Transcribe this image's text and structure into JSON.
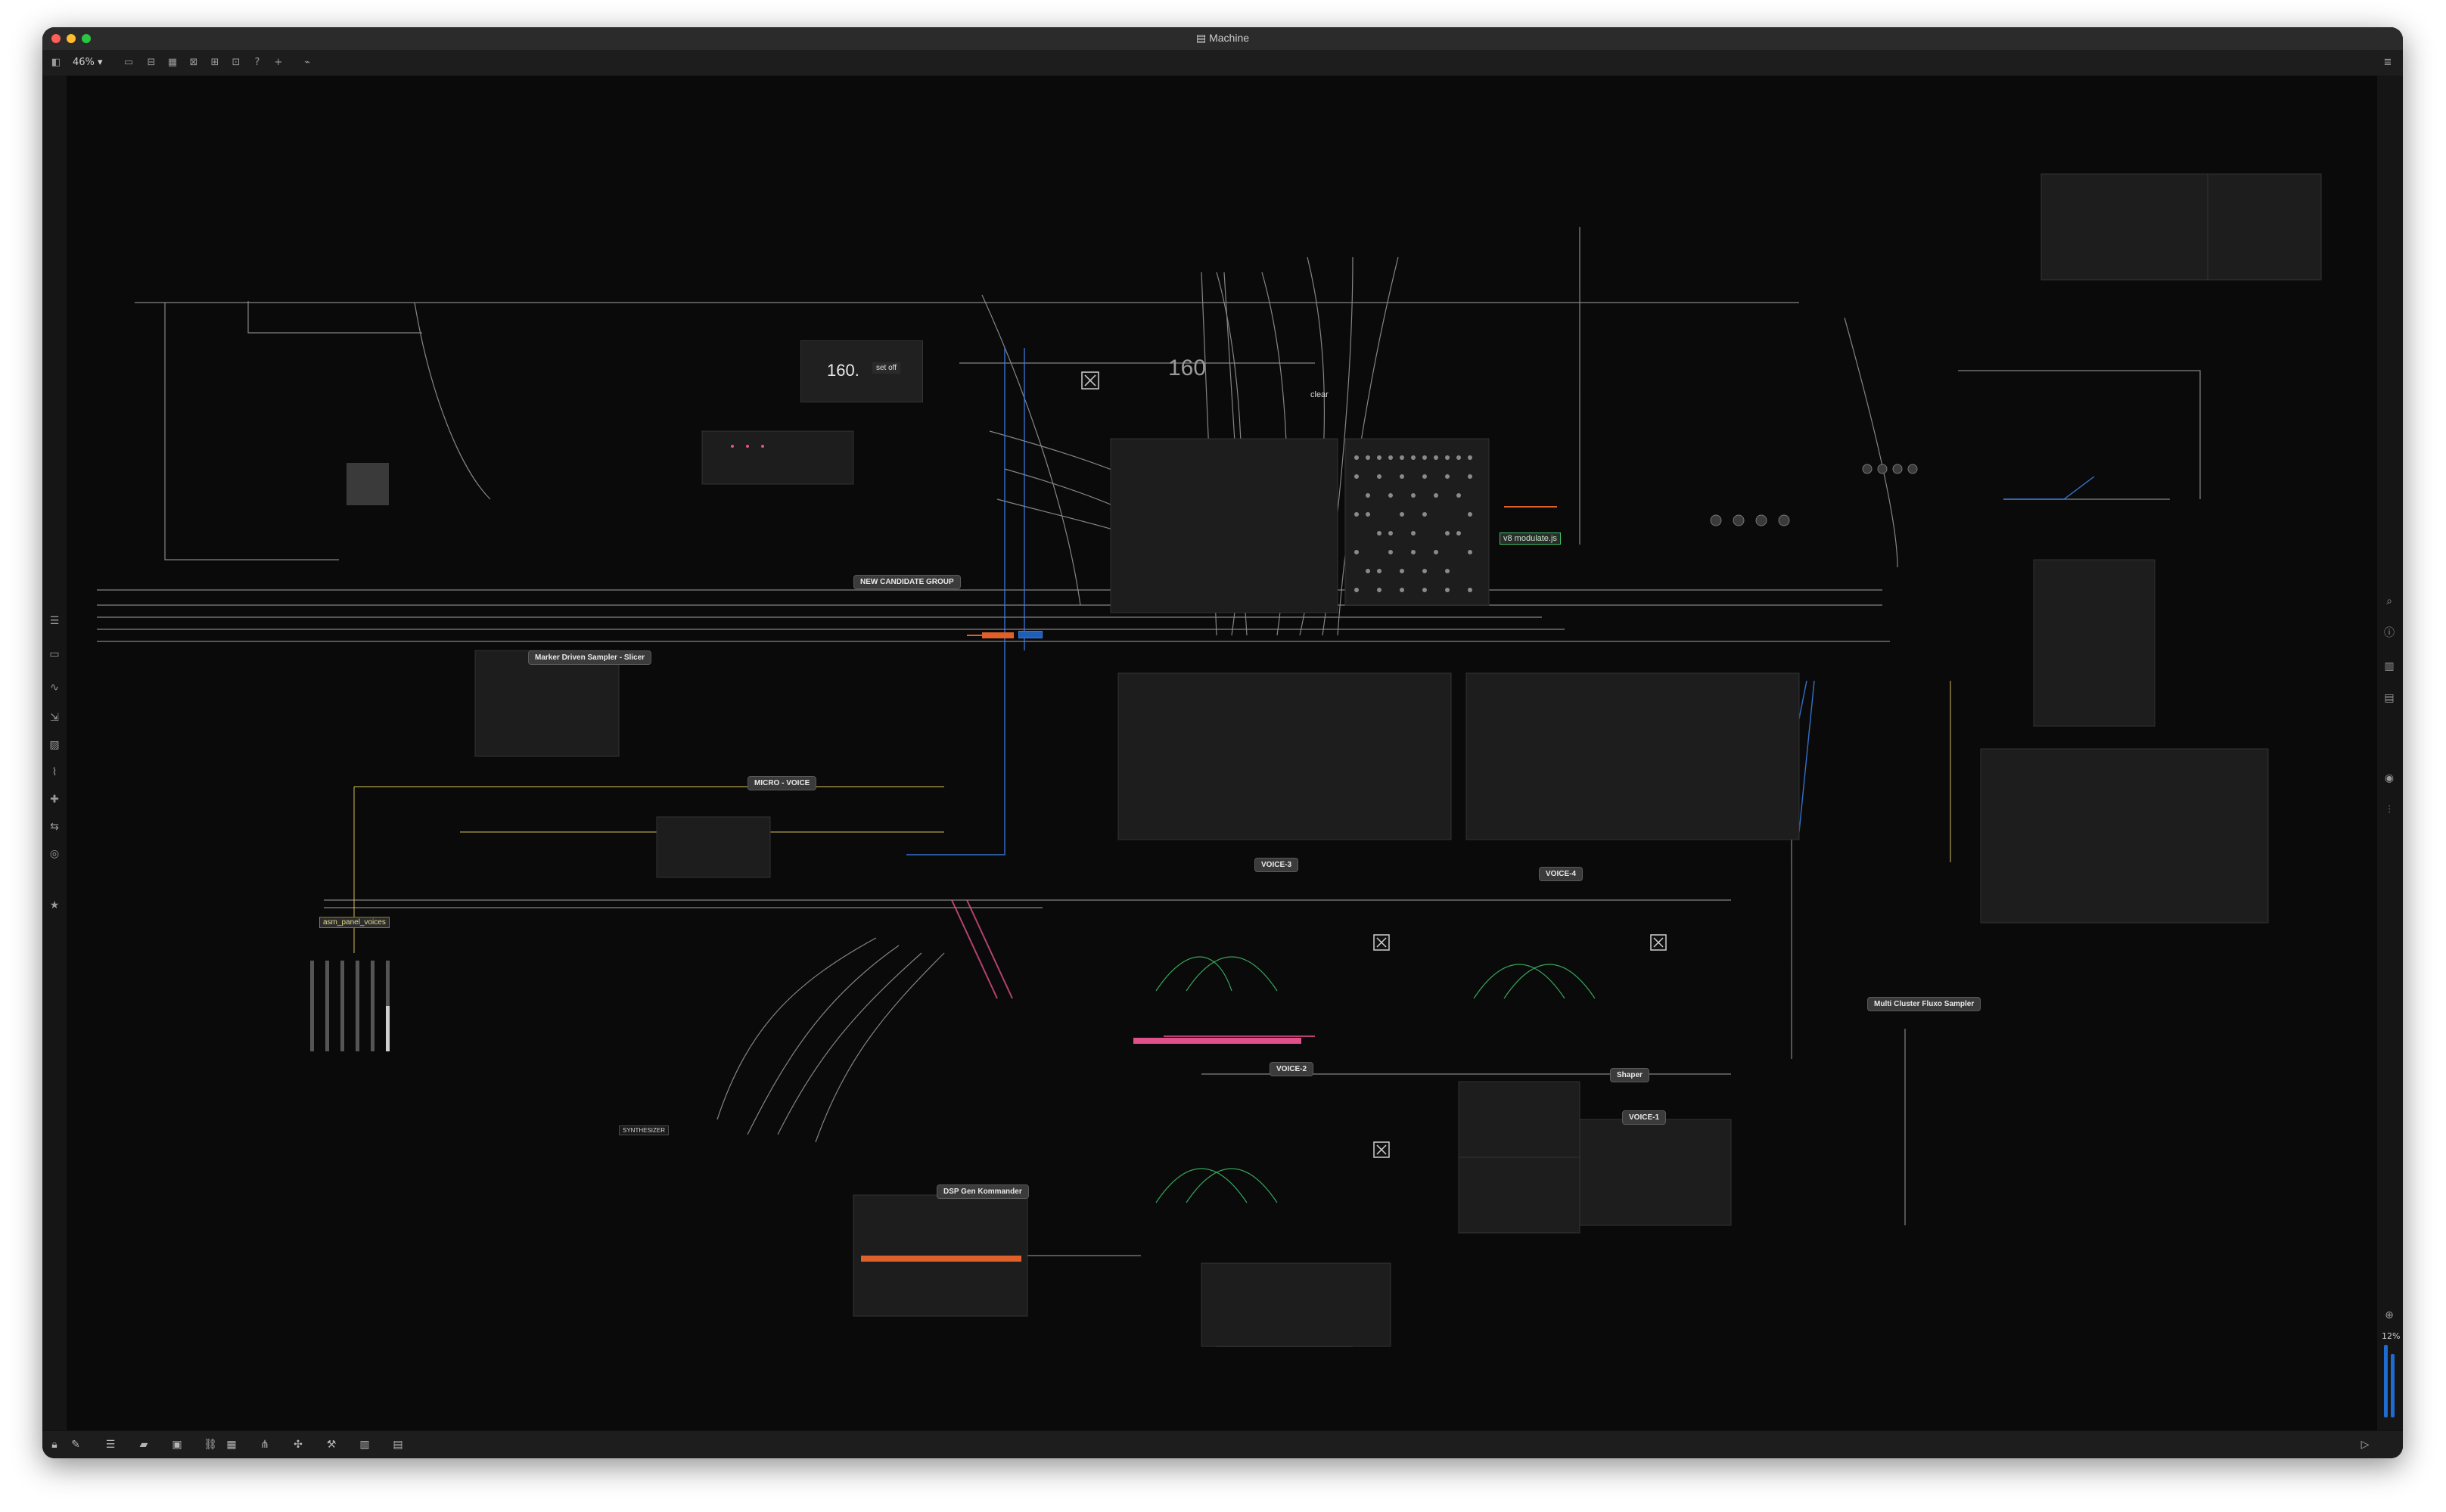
{
  "window": {
    "title": "Machine",
    "zoom": "46%"
  },
  "canvas": {
    "bpm": "160.",
    "bpm_big": "160",
    "set_label": "set off",
    "comments": {
      "new_candidate_group": "NEW CANDIDATE GROUP",
      "micro_voice": "MICRO - VOICE",
      "voice_3": "VOICE-3",
      "voice_4": "VOICE-4",
      "voice_2": "VOICE-2",
      "voice_1": "VOICE-1",
      "shaper": "Shaper",
      "marker_driven_sampler": "Marker Driven Sampler - Slicer",
      "dsp_gen_kommander": "DSP Gen Kommander",
      "multi_cluster_fluxo": "Multi Cluster Fluxo Sampler",
      "synthesizer": "SYNTHESIZER"
    },
    "objects": {
      "v8_modulate": "v8 modulate.js",
      "asm_panel_voices": "asm_panel_voices",
      "clear": "clear"
    }
  },
  "rightbar": {
    "zoom_pct": "12%"
  },
  "colors": {
    "window_bg": "#0b0b0b",
    "accent_blue": "#1e6bd1",
    "accent_green": "#3fbf6a",
    "accent_pink": "#e0508a",
    "accent_orange": "#e0602a",
    "accent_yellow": "#d9c35c",
    "patch_line": "#bdbdbd"
  },
  "icons": {
    "toolbar": [
      "sidebar-icon",
      "present-icon",
      "patch-icon",
      "comment-icon",
      "close-icon",
      "grid-icon",
      "lock-icon",
      "help-icon",
      "add-icon",
      "plug-icon"
    ],
    "toolbar_right": [
      "menu-icon"
    ],
    "leftbar": [
      "list-icon",
      "inspector-icon",
      "waveform-icon",
      "zoom-icon",
      "image-icon",
      "clip-icon",
      "puzzle-icon",
      "swap-icon",
      "layers-icon",
      "star-icon"
    ],
    "rightbar": [
      "search-icon",
      "info-icon",
      "book-icon",
      "library-icon",
      "camera-icon",
      "sliders-icon",
      "plus-icon",
      "power-icon"
    ],
    "statusbar": [
      "lock-icon",
      "edit-icon",
      "list-icon",
      "chat-icon",
      "console-icon",
      "link-icon",
      "grid-icon",
      "tree-icon",
      "debug-icon",
      "wrench-icon",
      "piano-icon",
      "keyboard-icon",
      "play-icon"
    ]
  }
}
